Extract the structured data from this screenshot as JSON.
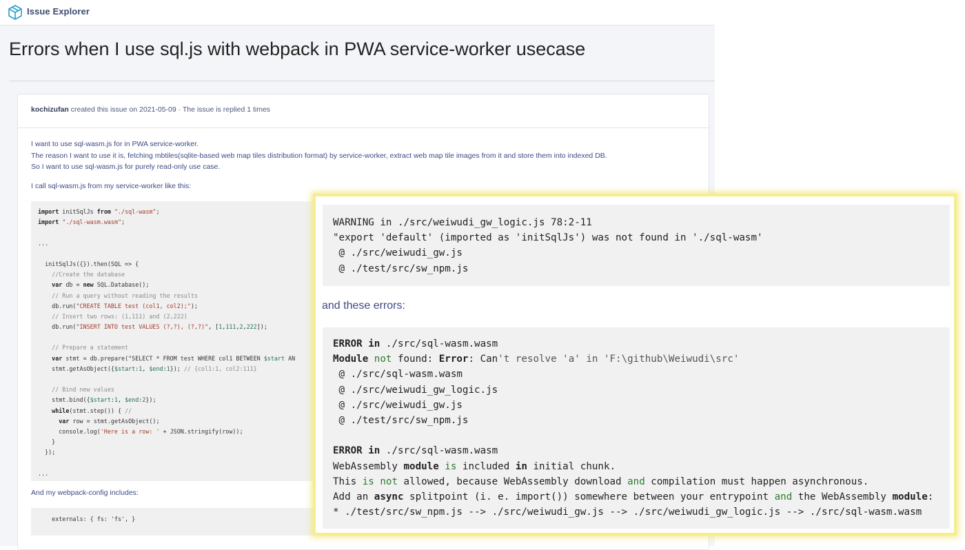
{
  "app": {
    "name": "Issue Explorer",
    "logo_icon": "cube-icon",
    "accent": "#2aa0c9"
  },
  "issue": {
    "title": "Errors when I use sql.js with webpack in PWA service-worker usecase",
    "author": "kochizufan",
    "meta_text": " created this issue on 2021-05-09 · The issue is replied 1 times"
  },
  "body": {
    "paragraph1": [
      "I want to use sql-wasm.js for in PWA service-worker.",
      "The reason I want to use it is, fetching mbtiles(sqlite-based web map tiles distribution format) by service-worker, extract web map tile images from it and store them into indexed DB.",
      "So I want to use sql-wasm.js for purely read-only use case."
    ],
    "paragraph2": "I call sql-wasm.js from my service-worker like this:",
    "code_lines": [
      "import initSqlJs from \"./sql-wasm\";",
      "import \"./sql-wasm.wasm\";",
      "",
      "...",
      "",
      "  initSqlJs({}).then(SQL => {",
      "    //Create the database",
      "    var db = new SQL.Database();",
      "    // Run a query without reading the results",
      "    db.run(\"CREATE TABLE test (col1, col2);\");",
      "    // Insert two rows: (1,111) and (2,222)",
      "    db.run(\"INSERT INTO test VALUES (?,?), (?,?)\", [1,111,2,222]);",
      "",
      "    // Prepare a statement",
      "    var stmt = db.prepare(\"SELECT * FROM test WHERE col1 BETWEEN $start AN",
      "    stmt.getAsObject({$start:1, $end:1}); // {col1:1, col2:111}",
      "",
      "    // Bind new values",
      "    stmt.bind({$start:1, $end:2});",
      "    while(stmt.step()) { //",
      "      var row = stmt.getAsObject();",
      "      console.log('Here is a row: ' + JSON.stringify(row));",
      "    }",
      "  });",
      "",
      "..."
    ],
    "paragraph3": "And my webpack-config includes:",
    "config_line": "    externals: { fs: 'fs', }"
  },
  "overlay": {
    "warning_lines": [
      "WARNING in ./src/weiwudi_gw_logic.js 78:2-11",
      "\"export 'default' (imported as 'initSqlJs') was not found in './sql-wasm'",
      " @ ./src/weiwudi_gw.js",
      " @ ./test/src/sw_npm.js"
    ],
    "and_these_errors": "and these errors:",
    "error_lines": [
      "ERROR in ./src/sql-wasm.wasm",
      "Module not found: Error: Can't resolve 'a' in 'F:\\github\\Weiwudi\\src'",
      " @ ./src/sql-wasm.wasm",
      " @ ./src/weiwudi_gw_logic.js",
      " @ ./src/weiwudi_gw.js",
      " @ ./test/src/sw_npm.js",
      "",
      "ERROR in ./src/sql-wasm.wasm",
      "WebAssembly module is included in initial chunk.",
      "This is not allowed, because WebAssembly download and compilation must happen asynchronous.",
      "Add an async splitpoint (i. e. import()) somewhere between your entrypoint and the WebAssembly module:",
      "* ./test/src/sw_npm.js --> ./src/weiwudi_gw.js --> ./src/weiwudi_gw_logic.js --> ./src/sql-wasm.wasm"
    ],
    "highlight_color": "#f5ee8f"
  }
}
